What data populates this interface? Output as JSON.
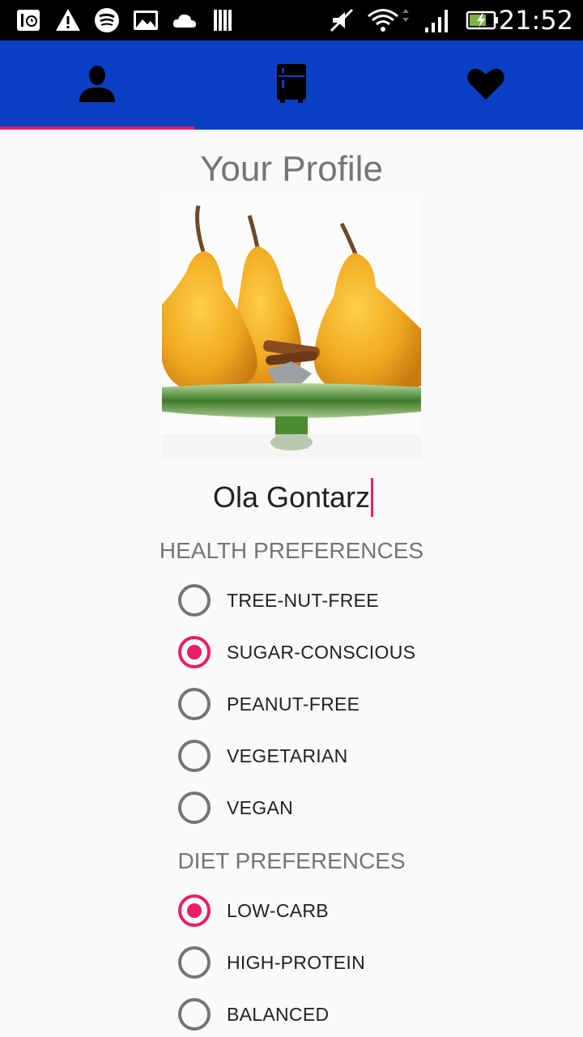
{
  "status_bar": {
    "time": "21:52",
    "icons": [
      "settings-clock-icon",
      "warning-icon",
      "spotify-icon",
      "image-icon",
      "cloud-icon",
      "library-icon",
      "muted-icon",
      "wifi-icon",
      "signal-icon",
      "battery-charging-icon"
    ]
  },
  "tabs": [
    {
      "icon": "person-icon",
      "selected": true
    },
    {
      "icon": "fridge-icon",
      "selected": false
    },
    {
      "icon": "heart-icon",
      "selected": false
    }
  ],
  "colors": {
    "tab_bar": "#0a3fc4",
    "accent": "#e91e63",
    "status_bar": "#000000"
  },
  "profile": {
    "title": "Your Profile",
    "name": "Ola Gontarz"
  },
  "health": {
    "title": "HEALTH PREFERENCES",
    "options": [
      {
        "label": "TREE-NUT-FREE",
        "checked": false
      },
      {
        "label": "SUGAR-CONSCIOUS",
        "checked": true
      },
      {
        "label": "PEANUT-FREE",
        "checked": false
      },
      {
        "label": "VEGETARIAN",
        "checked": false
      },
      {
        "label": "VEGAN",
        "checked": false
      }
    ]
  },
  "diet": {
    "title": "DIET PREFERENCES",
    "options": [
      {
        "label": "LOW-CARB",
        "checked": true
      },
      {
        "label": "HIGH-PROTEIN",
        "checked": false
      },
      {
        "label": "BALANCED",
        "checked": false
      }
    ]
  }
}
